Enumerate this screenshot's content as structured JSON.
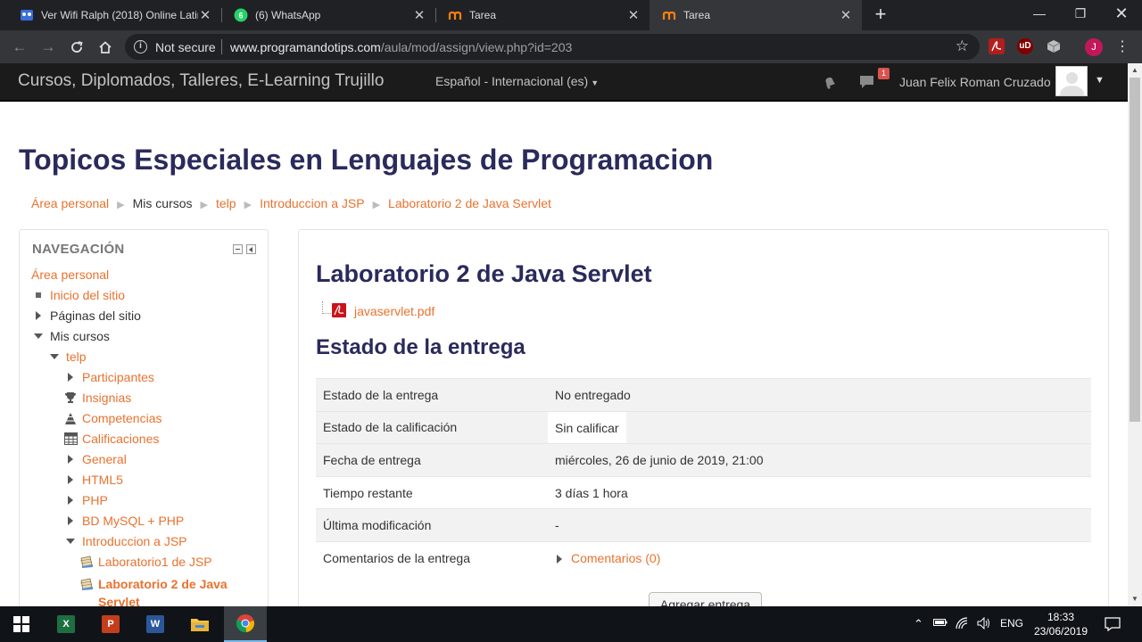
{
  "browser": {
    "tabs": [
      {
        "title": "Ver Wifi Ralph (2018) Online Latino",
        "icon": "video-site-icon",
        "active": false
      },
      {
        "title": "(6) WhatsApp",
        "icon": "whatsapp-icon",
        "active": false
      },
      {
        "title": "Tarea",
        "icon": "moodle-icon",
        "active": false
      },
      {
        "title": "Tarea",
        "icon": "moodle-icon",
        "active": true
      }
    ],
    "security_label": "Not secure",
    "url_domain": "www.programandotips.com",
    "url_path": "/aula/mod/assign/view.php?id=203",
    "profile_initial": "J",
    "extensions": [
      "pdf-extension-icon",
      "ublock-icon",
      "cube-extension-icon"
    ]
  },
  "moodle_nav": {
    "brand": "Cursos, Diplomados, Talleres, E-Learning Trujillo",
    "language": "Español - Internacional (es)",
    "message_badge": "1",
    "user_name": "Juan Felix Roman Cruzado"
  },
  "page": {
    "course_title": "Topicos Especiales en Lenguajes de Programacion",
    "breadcrumb": [
      {
        "label": "Área personal",
        "link": true
      },
      {
        "label": "Mis cursos",
        "link": false
      },
      {
        "label": "telp",
        "link": true
      },
      {
        "label": "Introduccion a JSP",
        "link": true
      },
      {
        "label": "Laboratorio 2 de Java Servlet",
        "link": true
      }
    ]
  },
  "navigation": {
    "heading": "NAVEGACIÓN",
    "items": [
      {
        "label": "Área personal"
      },
      {
        "label": "Inicio del sitio"
      },
      {
        "label": "Páginas del sitio"
      },
      {
        "label": "Mis cursos"
      },
      {
        "label": "telp"
      },
      {
        "label": "Participantes"
      },
      {
        "label": "Insignias"
      },
      {
        "label": "Competencias"
      },
      {
        "label": "Calificaciones"
      },
      {
        "label": "General"
      },
      {
        "label": "HTML5"
      },
      {
        "label": "PHP"
      },
      {
        "label": "BD MySQL + PHP"
      },
      {
        "label": "Introduccion a JSP"
      },
      {
        "label": "Laboratorio1 de JSP"
      },
      {
        "label_line1": "Laboratorio 2 de Java",
        "label_line2": "Servlet"
      }
    ]
  },
  "assignment": {
    "title": "Laboratorio 2 de Java Servlet",
    "file": "javaservlet.pdf",
    "status_heading": "Estado de la entrega",
    "rows": [
      {
        "label": "Estado de la entrega",
        "value": "No entregado"
      },
      {
        "label": "Estado de la calificación",
        "value": "Sin calificar"
      },
      {
        "label": "Fecha de entrega",
        "value": "miércoles, 26 de junio de 2019, 21:00"
      },
      {
        "label": "Tiempo restante",
        "value": "3 días 1 hora"
      },
      {
        "label": "Última modificación",
        "value": "-"
      },
      {
        "label": "Comentarios de la entrega",
        "value": "Comentarios (0)"
      }
    ],
    "add_button": "Agregar entrega"
  },
  "taskbar": {
    "language": "ENG",
    "time": "18:33",
    "date": "23/06/2019",
    "apps": [
      "excel-icon",
      "powerpoint-icon",
      "word-icon",
      "file-explorer-icon",
      "chrome-icon"
    ]
  },
  "colors": {
    "link": "#e8722f",
    "heading": "#2a2a5c",
    "navbar": "#1b1b1b"
  }
}
